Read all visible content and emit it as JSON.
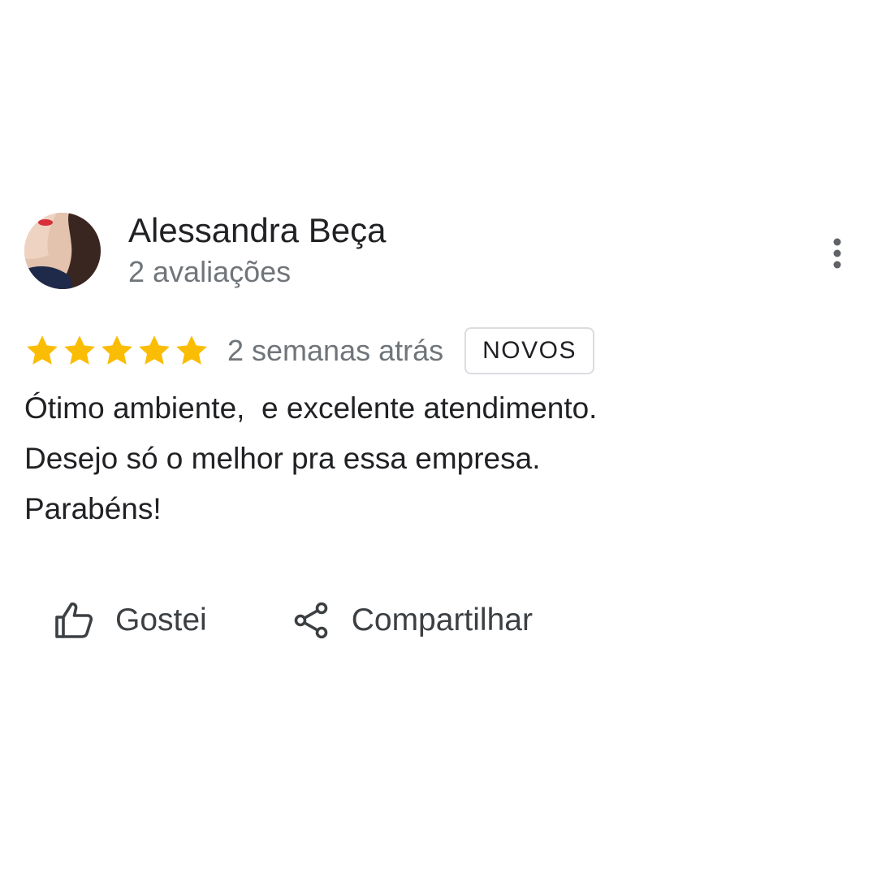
{
  "review": {
    "author": {
      "name": "Alessandra Beça",
      "reviews_count": "2 avaliações"
    },
    "rating": 5,
    "rating_max": 5,
    "date": "2 semanas atrás",
    "badge": "NOVOS",
    "text_lines": [
      "Ótimo ambiente,  e excelente atendimento.",
      "Desejo só o melhor pra essa empresa.",
      "Parabéns!"
    ]
  },
  "actions": {
    "like_label": "Gostei",
    "share_label": "Compartilhar"
  },
  "icons": {
    "star": "star-icon",
    "more": "more-vert-icon",
    "like": "thumb-up-icon",
    "share": "share-icon"
  },
  "colors": {
    "star": "#fbbc04",
    "text_primary": "#202124",
    "text_secondary": "#70757a",
    "badge_border": "#dadce0"
  }
}
